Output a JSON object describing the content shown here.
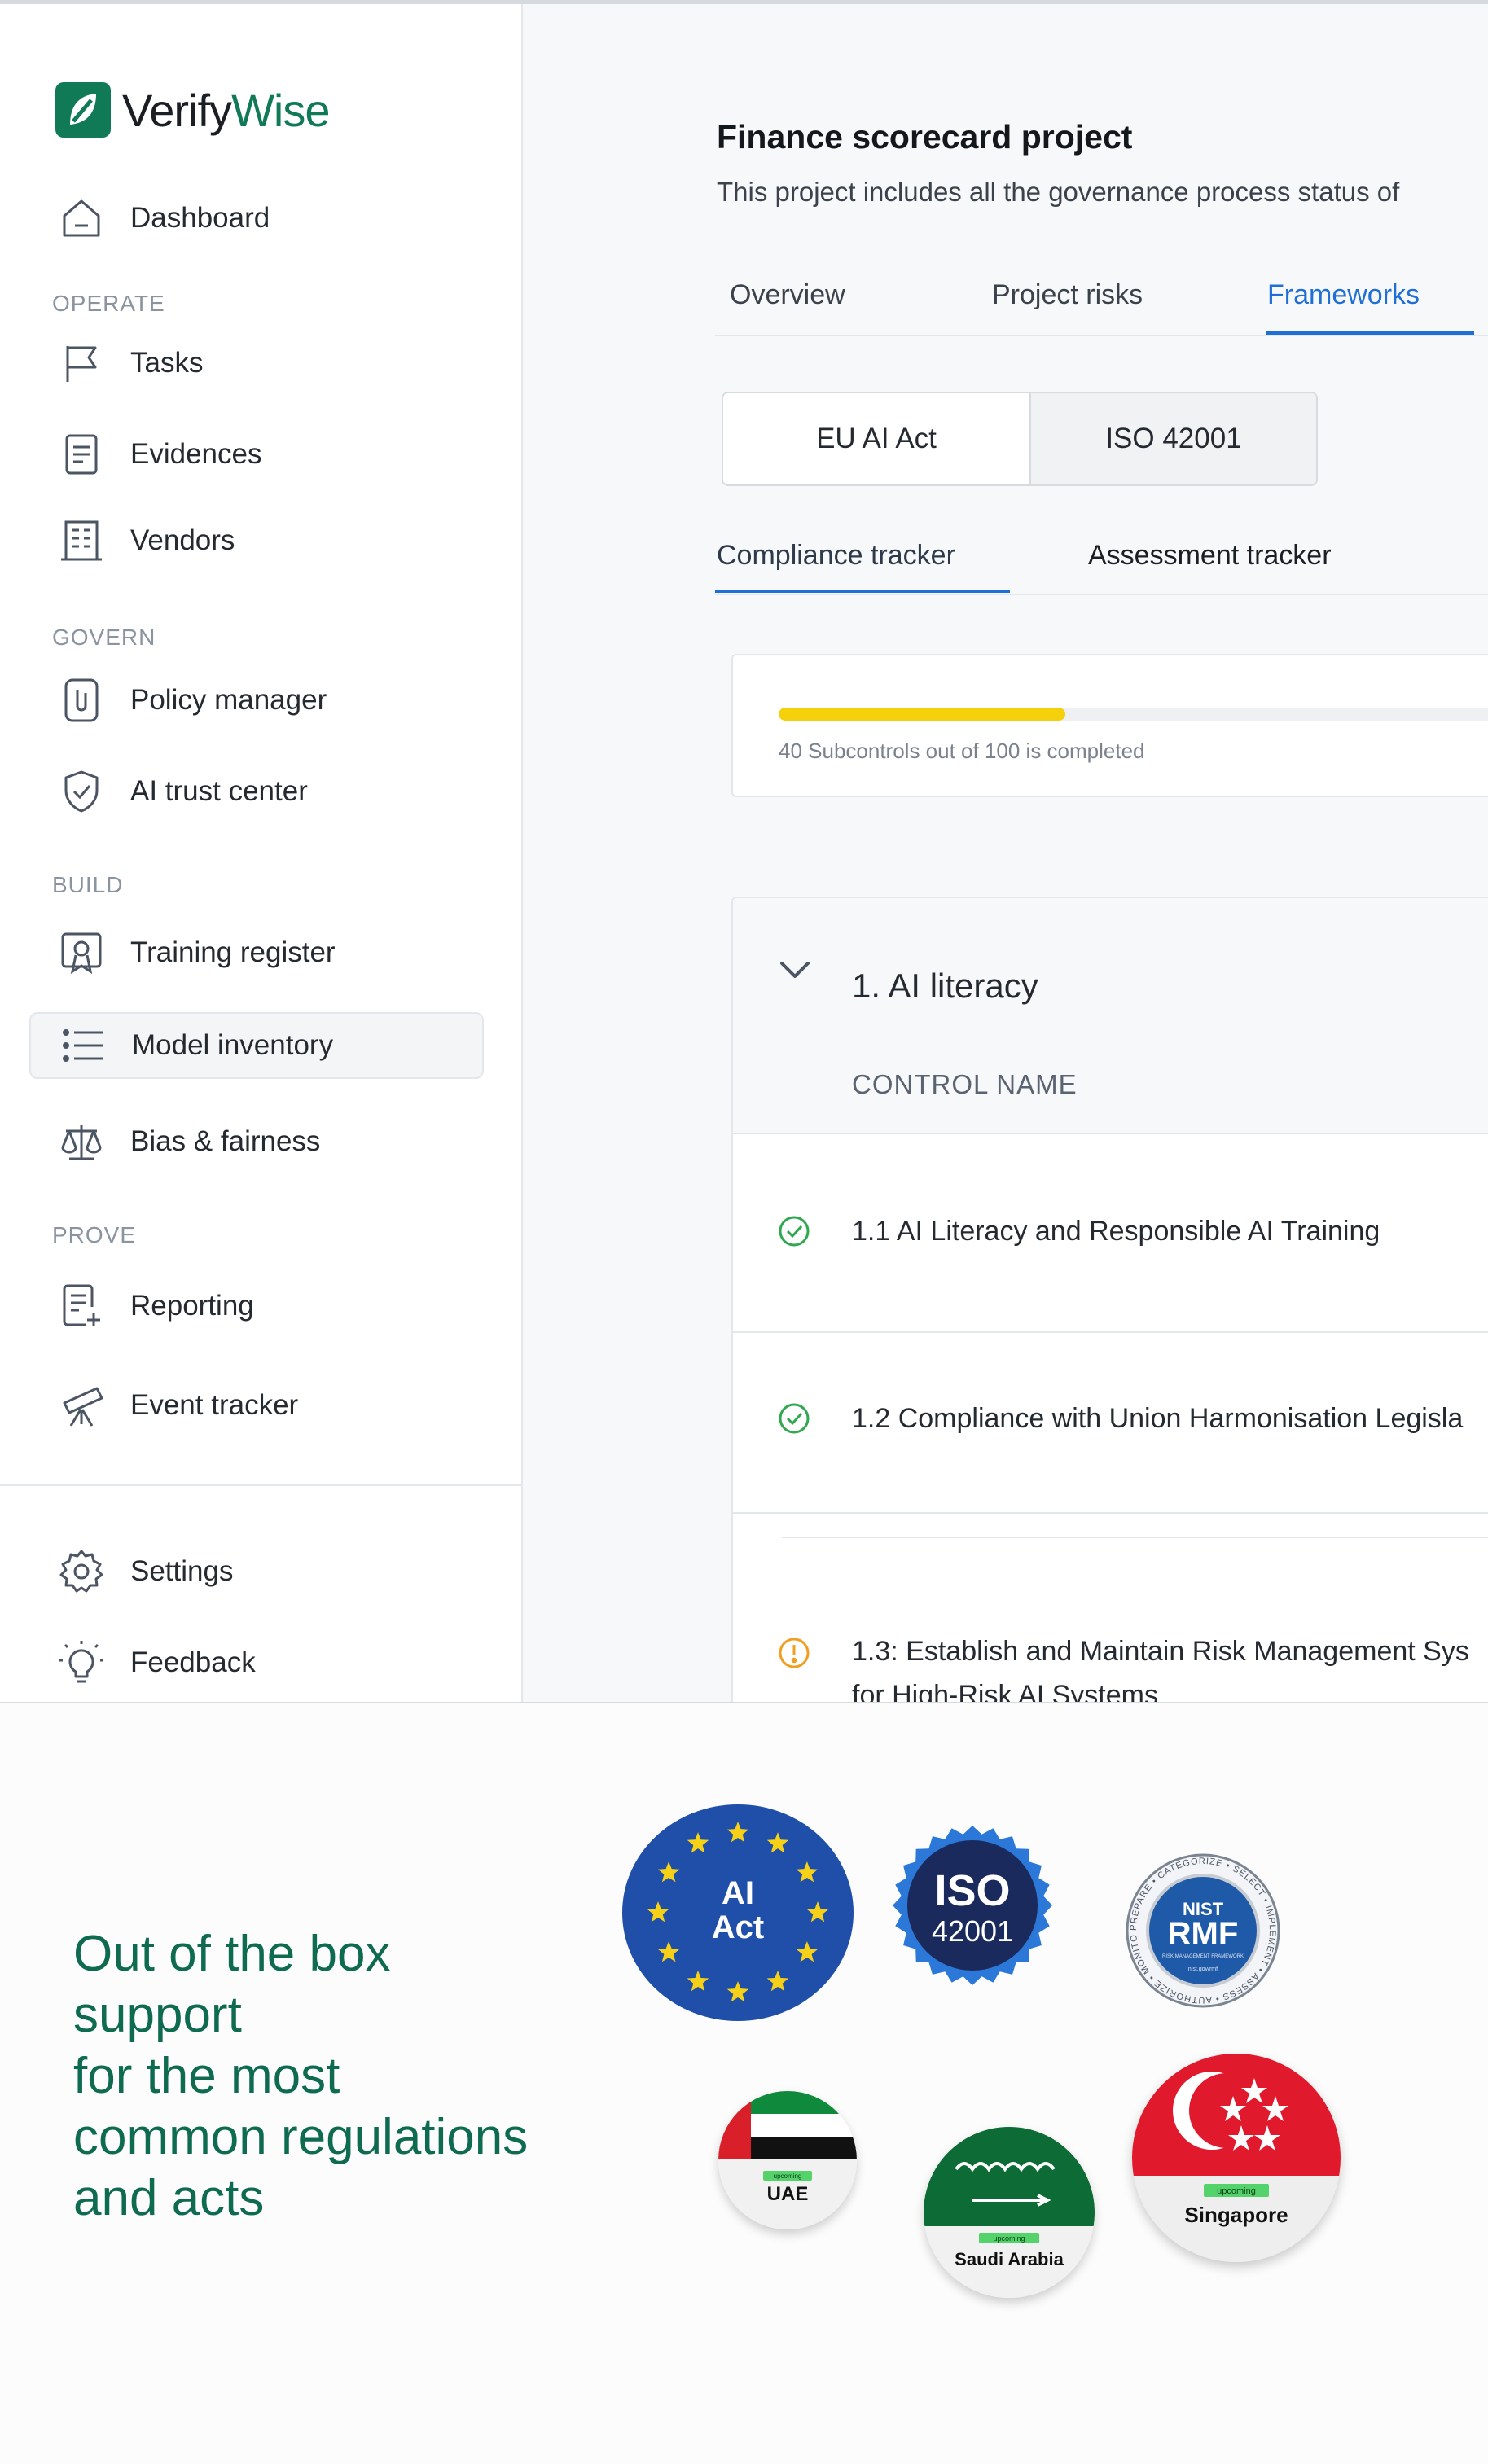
{
  "brand": {
    "name_part1": "Verify",
    "name_part2": "Wise",
    "color": "#0f7a55"
  },
  "sidebar": {
    "dashboard": "Dashboard",
    "sections": {
      "operate": "OPERATE",
      "govern": "GOVERN",
      "build": "BUILD",
      "prove": "PROVE"
    },
    "items": [
      {
        "label": "Tasks",
        "icon": "flag-icon"
      },
      {
        "label": "Evidences",
        "icon": "document-icon"
      },
      {
        "label": "Vendors",
        "icon": "building-icon"
      },
      {
        "label": "Policy manager",
        "icon": "paperclip-icon"
      },
      {
        "label": "AI trust center",
        "icon": "shield-check-icon"
      },
      {
        "label": "Training register",
        "icon": "certificate-icon"
      },
      {
        "label": "Model inventory",
        "icon": "list-icon",
        "active": true
      },
      {
        "label": "Bias & fairness",
        "icon": "scale-icon"
      },
      {
        "label": "Reporting",
        "icon": "report-icon"
      },
      {
        "label": "Event tracker",
        "icon": "telescope-icon"
      }
    ],
    "settings": "Settings",
    "feedback": "Feedback"
  },
  "project": {
    "title": "Finance scorecard project",
    "description": "This project includes all the governance process status of"
  },
  "tabs": {
    "overview": "Overview",
    "risks": "Project risks",
    "frameworks": "Frameworks"
  },
  "frameworks": {
    "eu": "EU AI Act",
    "iso": "ISO 42001"
  },
  "subtabs": {
    "compliance": "Compliance tracker",
    "assessment": "Assessment tracker"
  },
  "progress": {
    "completed": 40,
    "total": 100,
    "fraction": 0.4,
    "text": "40 Subcontrols out of 100 is completed"
  },
  "accordion": {
    "title": "1. AI literacy",
    "column_header": "CONTROL NAME",
    "rows": [
      {
        "status": "complete",
        "line1": "1.1 AI Literacy and Responsible AI Training",
        "line2": ""
      },
      {
        "status": "complete",
        "line1": "1.2 Compliance with Union Harmonisation Legisla",
        "line2": ""
      },
      {
        "status": "warning",
        "line1": "1.3: Establish and Maintain Risk Management Sys",
        "line2": "for High-Risk AI Systems"
      }
    ]
  },
  "colors": {
    "accent": "#1f6fd6",
    "progress": "#f5d10c",
    "complete": "#2fa84f",
    "warning": "#f0a020",
    "headline": "#0f6b50"
  },
  "band": {
    "headline": [
      "Out of the box",
      "support",
      "for the most",
      "common regulations",
      "and acts"
    ],
    "badges": {
      "ai_act": [
        "AI",
        "Act"
      ],
      "iso": [
        "ISO",
        "42001"
      ],
      "nist": {
        "top": "NIST",
        "main": "RMF",
        "sub": "RISK MANAGEMENT FRAMEWORK",
        "foot": "nist.gov/rmf",
        "ring": [
          "PREPARE",
          "CATEGORIZE",
          "SELECT",
          "IMPLEMENT",
          "ASSESS",
          "AUTHORIZE",
          "MONITOR"
        ]
      },
      "uae": {
        "tag": "upcoming",
        "label": "UAE"
      },
      "saudi": {
        "tag": "upcoming",
        "label": "Saudi Arabia"
      },
      "singapore": {
        "tag": "upcoming",
        "label": "Singapore"
      }
    }
  }
}
